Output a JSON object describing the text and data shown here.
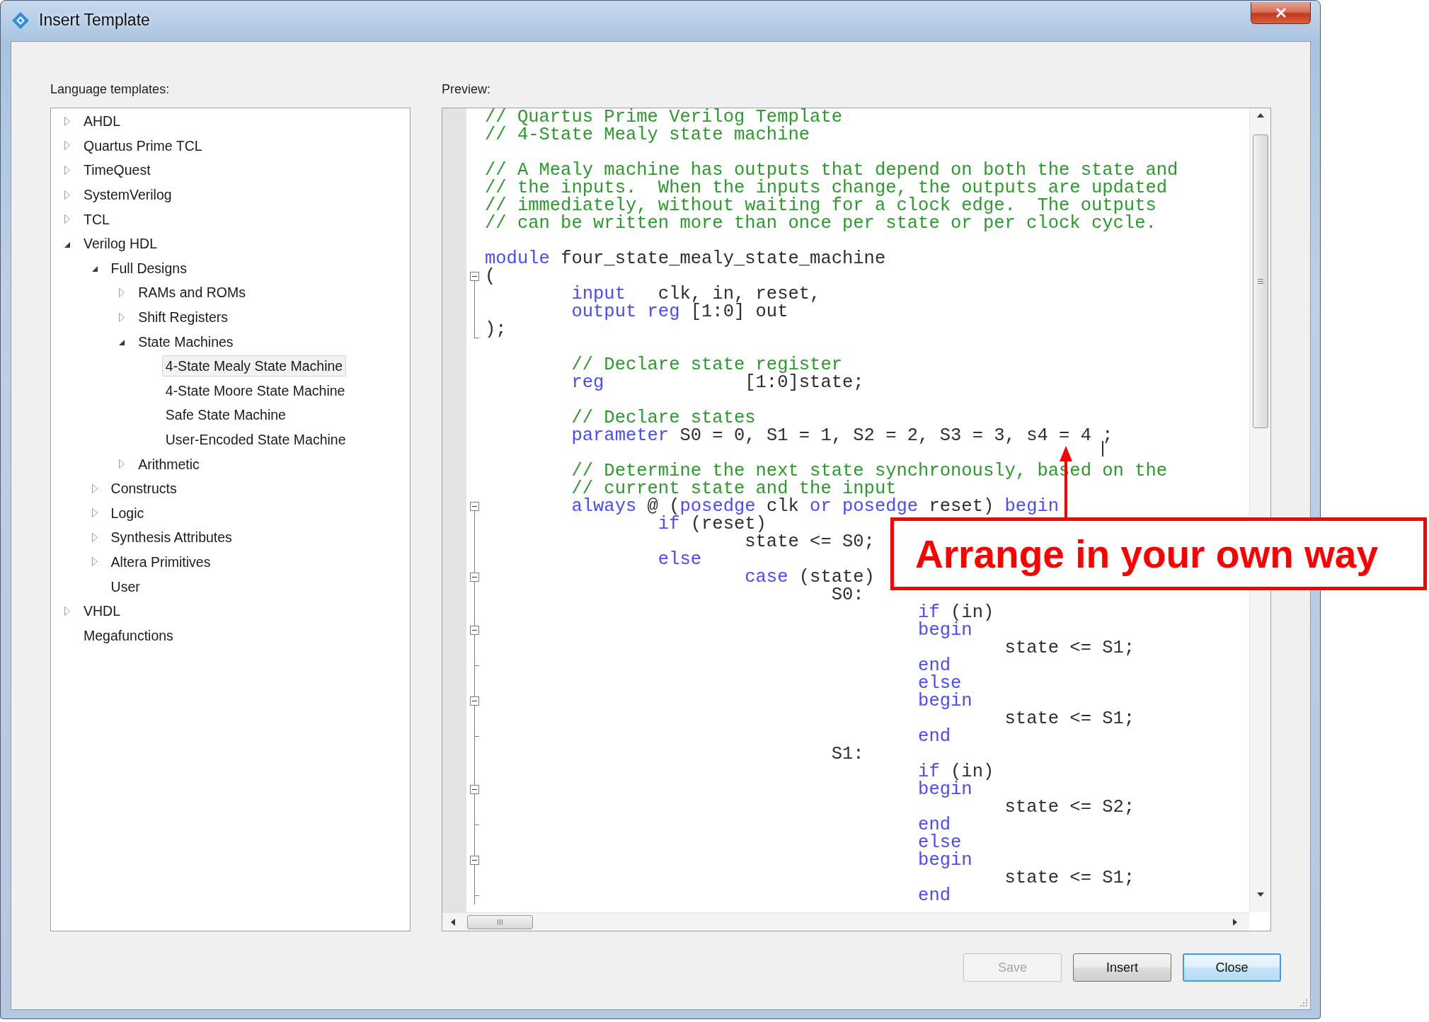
{
  "window": {
    "title": "Insert Template"
  },
  "templates_panel": {
    "label": "Language templates:",
    "tree": [
      {
        "label": "AHDL",
        "kind": "expandable",
        "expanded": false,
        "selected": false
      },
      {
        "label": "Quartus Prime TCL",
        "kind": "expandable",
        "expanded": false,
        "selected": false
      },
      {
        "label": "TimeQuest",
        "kind": "expandable",
        "expanded": false,
        "selected": false
      },
      {
        "label": "SystemVerilog",
        "kind": "expandable",
        "expanded": false,
        "selected": false
      },
      {
        "label": "TCL",
        "kind": "expandable",
        "expanded": false,
        "selected": false
      },
      {
        "label": "Verilog HDL",
        "kind": "expandable",
        "expanded": true,
        "selected": false,
        "children": [
          {
            "label": "Full Designs",
            "kind": "expandable",
            "expanded": true,
            "selected": false,
            "children": [
              {
                "label": "RAMs and ROMs",
                "kind": "expandable",
                "expanded": false,
                "selected": false
              },
              {
                "label": "Shift Registers",
                "kind": "expandable",
                "expanded": false,
                "selected": false
              },
              {
                "label": "State Machines",
                "kind": "expandable",
                "expanded": true,
                "selected": false,
                "children": [
                  {
                    "label": "4-State Mealy State Machine",
                    "kind": "leaf",
                    "selected": true
                  },
                  {
                    "label": "4-State Moore State Machine",
                    "kind": "leaf",
                    "selected": false
                  },
                  {
                    "label": "Safe State Machine",
                    "kind": "leaf",
                    "selected": false
                  },
                  {
                    "label": "User-Encoded State Machine",
                    "kind": "leaf",
                    "selected": false
                  }
                ]
              },
              {
                "label": "Arithmetic",
                "kind": "expandable",
                "expanded": false,
                "selected": false
              }
            ]
          },
          {
            "label": "Constructs",
            "kind": "expandable",
            "expanded": false,
            "selected": false
          },
          {
            "label": "Logic",
            "kind": "expandable",
            "expanded": false,
            "selected": false
          },
          {
            "label": "Synthesis Attributes",
            "kind": "expandable",
            "expanded": false,
            "selected": false
          },
          {
            "label": "Altera Primitives",
            "kind": "expandable",
            "expanded": false,
            "selected": false
          },
          {
            "label": "User",
            "kind": "leaf",
            "selected": false
          }
        ]
      },
      {
        "label": "VHDL",
        "kind": "expandable",
        "expanded": false,
        "selected": false
      },
      {
        "label": "Megafunctions",
        "kind": "leaf",
        "selected": false
      }
    ]
  },
  "preview_panel": {
    "label": "Preview:",
    "code_lines": [
      {
        "kind": "code",
        "segments": [
          {
            "kind": "comment",
            "text": "// Quartus Prime Verilog Template"
          }
        ]
      },
      {
        "kind": "code",
        "segments": [
          {
            "kind": "comment",
            "text": "// 4-State Mealy state machine"
          }
        ]
      },
      {
        "kind": "blank"
      },
      {
        "kind": "code",
        "segments": [
          {
            "kind": "comment",
            "text": "// A Mealy machine has outputs that depend on both the state and"
          }
        ]
      },
      {
        "kind": "code",
        "segments": [
          {
            "kind": "comment",
            "text": "// the inputs.  When the inputs change, the outputs are updated"
          }
        ]
      },
      {
        "kind": "code",
        "segments": [
          {
            "kind": "comment",
            "text": "// immediately, without waiting for a clock edge.  The outputs"
          }
        ]
      },
      {
        "kind": "code",
        "segments": [
          {
            "kind": "comment",
            "text": "// can be written more than once per state or per clock cycle."
          }
        ]
      },
      {
        "kind": "blank"
      },
      {
        "kind": "code",
        "segments": [
          {
            "kind": "keyword",
            "text": "module"
          },
          {
            "kind": "text",
            "text": " four_state_mealy_state_machine"
          }
        ]
      },
      {
        "kind": "code",
        "fold_marker": {
          "kind": "box"
        },
        "segments": [
          {
            "kind": "text",
            "text": "("
          }
        ]
      },
      {
        "kind": "code",
        "fold_marker": {
          "kind": "line"
        },
        "segments": [
          {
            "kind": "keyword",
            "text": "\tinput"
          },
          {
            "kind": "text",
            "text": "\tclk, in, reset,"
          }
        ]
      },
      {
        "kind": "code",
        "fold_marker": {
          "kind": "line"
        },
        "segments": [
          {
            "kind": "keyword",
            "text": "\toutput reg"
          },
          {
            "kind": "text",
            "text": " [1:0] out"
          }
        ]
      },
      {
        "kind": "code",
        "fold_marker": {
          "kind": "corner"
        },
        "segments": [
          {
            "kind": "text",
            "text": ");"
          }
        ]
      },
      {
        "kind": "blank"
      },
      {
        "kind": "code",
        "segments": [
          {
            "kind": "comment",
            "text": "\t// Declare state register"
          }
        ]
      },
      {
        "kind": "code",
        "segments": [
          {
            "kind": "keyword",
            "text": "\treg"
          },
          {
            "kind": "text",
            "text": "\t\t[1:0]state;"
          }
        ]
      },
      {
        "kind": "blank"
      },
      {
        "kind": "code",
        "segments": [
          {
            "kind": "comment",
            "text": "\t// Declare states"
          }
        ]
      },
      {
        "kind": "code",
        "segments": [
          {
            "kind": "keyword",
            "text": "\tparameter"
          },
          {
            "kind": "text",
            "text": " S0 = 0, S1 = 1, S2 = 2, S3 = 3, s4 = 4 "
          },
          {
            "kind": "caret"
          },
          {
            "kind": "text",
            "text": ";"
          }
        ]
      },
      {
        "kind": "blank"
      },
      {
        "kind": "code",
        "segments": [
          {
            "kind": "comment",
            "text": "\t// Determine the next state synchronously, based on the"
          }
        ]
      },
      {
        "kind": "code",
        "segments": [
          {
            "kind": "comment",
            "text": "\t// current state and the input"
          }
        ]
      },
      {
        "kind": "code",
        "fold_marker": {
          "kind": "box"
        },
        "segments": [
          {
            "kind": "keyword",
            "text": "\talways"
          },
          {
            "kind": "text",
            "text": " @ ("
          },
          {
            "kind": "keyword",
            "text": "posedge"
          },
          {
            "kind": "text",
            "text": " clk "
          },
          {
            "kind": "keyword",
            "text": "or posedge"
          },
          {
            "kind": "text",
            "text": " reset) "
          },
          {
            "kind": "keyword",
            "text": "begin"
          }
        ]
      },
      {
        "kind": "code",
        "fold_marker": {
          "kind": "line"
        },
        "segments": [
          {
            "kind": "keyword",
            "text": "\t\tif"
          },
          {
            "kind": "text",
            "text": " (reset)"
          }
        ]
      },
      {
        "kind": "code",
        "fold_marker": {
          "kind": "line"
        },
        "segments": [
          {
            "kind": "text",
            "text": "\t\t\tstate <= S0;"
          }
        ]
      },
      {
        "kind": "code",
        "fold_marker": {
          "kind": "line"
        },
        "segments": [
          {
            "kind": "keyword",
            "text": "\t\telse"
          }
        ]
      },
      {
        "kind": "code",
        "fold_marker": {
          "kind": "box"
        },
        "segments": [
          {
            "kind": "keyword",
            "text": "\t\t\tcase"
          },
          {
            "kind": "text",
            "text": " (state)"
          }
        ]
      },
      {
        "kind": "code",
        "fold_marker": {
          "kind": "line"
        },
        "segments": [
          {
            "kind": "text",
            "text": "\t\t\t\tS0:"
          }
        ]
      },
      {
        "kind": "code",
        "fold_marker": {
          "kind": "line"
        },
        "segments": [
          {
            "kind": "keyword",
            "text": "\t\t\t\t\tif"
          },
          {
            "kind": "text",
            "text": " (in)"
          }
        ]
      },
      {
        "kind": "code",
        "fold_marker": {
          "kind": "box"
        },
        "segments": [
          {
            "kind": "keyword",
            "text": "\t\t\t\t\tbegin"
          }
        ]
      },
      {
        "kind": "code",
        "fold_marker": {
          "kind": "line"
        },
        "segments": [
          {
            "kind": "text",
            "text": "\t\t\t\t\t\tstate <= S1;"
          }
        ]
      },
      {
        "kind": "code",
        "fold_marker": {
          "kind": "tee"
        },
        "segments": [
          {
            "kind": "keyword",
            "text": "\t\t\t\t\tend"
          }
        ]
      },
      {
        "kind": "code",
        "fold_marker": {
          "kind": "line"
        },
        "segments": [
          {
            "kind": "keyword",
            "text": "\t\t\t\t\telse"
          }
        ]
      },
      {
        "kind": "code",
        "fold_marker": {
          "kind": "box"
        },
        "segments": [
          {
            "kind": "keyword",
            "text": "\t\t\t\t\tbegin"
          }
        ]
      },
      {
        "kind": "code",
        "fold_marker": {
          "kind": "line"
        },
        "segments": [
          {
            "kind": "text",
            "text": "\t\t\t\t\t\tstate <= S1;"
          }
        ]
      },
      {
        "kind": "code",
        "fold_marker": {
          "kind": "tee"
        },
        "segments": [
          {
            "kind": "keyword",
            "text": "\t\t\t\t\tend"
          }
        ]
      },
      {
        "kind": "code",
        "fold_marker": {
          "kind": "line"
        },
        "segments": [
          {
            "kind": "text",
            "text": "\t\t\t\tS1:"
          }
        ]
      },
      {
        "kind": "code",
        "fold_marker": {
          "kind": "line"
        },
        "segments": [
          {
            "kind": "keyword",
            "text": "\t\t\t\t\tif"
          },
          {
            "kind": "text",
            "text": " (in)"
          }
        ]
      },
      {
        "kind": "code",
        "fold_marker": {
          "kind": "box"
        },
        "segments": [
          {
            "kind": "keyword",
            "text": "\t\t\t\t\tbegin"
          }
        ]
      },
      {
        "kind": "code",
        "fold_marker": {
          "kind": "line"
        },
        "segments": [
          {
            "kind": "text",
            "text": "\t\t\t\t\t\tstate <= S2;"
          }
        ]
      },
      {
        "kind": "code",
        "fold_marker": {
          "kind": "tee"
        },
        "segments": [
          {
            "kind": "keyword",
            "text": "\t\t\t\t\tend"
          }
        ]
      },
      {
        "kind": "code",
        "fold_marker": {
          "kind": "line"
        },
        "segments": [
          {
            "kind": "keyword",
            "text": "\t\t\t\t\telse"
          }
        ]
      },
      {
        "kind": "code",
        "fold_marker": {
          "kind": "box"
        },
        "segments": [
          {
            "kind": "keyword",
            "text": "\t\t\t\t\tbegin"
          }
        ]
      },
      {
        "kind": "code",
        "fold_marker": {
          "kind": "line"
        },
        "segments": [
          {
            "kind": "text",
            "text": "\t\t\t\t\t\tstate <= S1;"
          }
        ]
      },
      {
        "kind": "code",
        "fold_marker": {
          "kind": "tee"
        },
        "segments": [
          {
            "kind": "keyword",
            "text": "\t\t\t\t\tend"
          }
        ]
      }
    ]
  },
  "buttons": [
    {
      "label": "Save",
      "disabled": true,
      "default": false
    },
    {
      "label": "Insert",
      "disabled": false,
      "default": false
    },
    {
      "label": "Close",
      "disabled": false,
      "default": true
    }
  ],
  "annotation": {
    "text": "Arrange in your own way"
  }
}
